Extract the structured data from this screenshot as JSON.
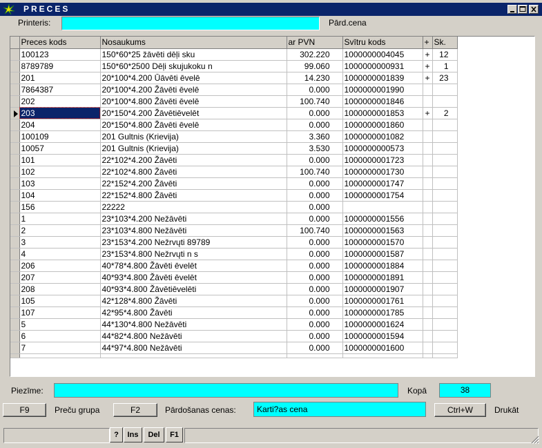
{
  "window": {
    "title": "PRECES"
  },
  "header": {
    "printeris_label": "Printeris:",
    "printeris_value": "",
    "pard_cena_label": "Pārd.cena"
  },
  "table": {
    "columns": [
      "Preces kods",
      "Nosaukums",
      "ar PVN",
      "Svītru kods",
      "+",
      "Sk."
    ],
    "selected_index": 5,
    "rows": [
      [
        "100123",
        "150*60*25 žāvēti dēļi sku",
        "302.220",
        "1000000004045",
        "+",
        "12"
      ],
      [
        "8789789",
        "150*60*2500 Dēļi skujukoku n",
        "99.060",
        "1000000000931",
        "+",
        "1"
      ],
      [
        "201",
        "20*100*4.200 Ūāvēti ēvelē",
        "14.230",
        "1000000001839",
        "+",
        "23"
      ],
      [
        "7864387",
        "20*100*4.200 Žāvēti ēvelē",
        "0.000",
        "1000000001990",
        "",
        ""
      ],
      [
        "202",
        "20*100*4.800 Žāvēti ēvelē",
        "100.740",
        "1000000001846",
        "",
        ""
      ],
      [
        "203",
        "20*150*4.200 Žāvētiēvelēt",
        "0.000",
        "1000000001853",
        "+",
        "2"
      ],
      [
        "204",
        "20*150*4.800 Žāvēti ēvelē",
        "0.000",
        "1000000001860",
        "",
        ""
      ],
      [
        "100109",
        "201 Gultnis (Krievija)",
        "3.360",
        "1000000001082",
        "",
        ""
      ],
      [
        "10057",
        "201 Gultnis (Krievija)",
        "3.530",
        "1000000000573",
        "",
        ""
      ],
      [
        "101",
        "22*102*4.200 Žāvēti",
        "0.000",
        "1000000001723",
        "",
        ""
      ],
      [
        "102",
        "22*102*4.800 Žāvēti",
        "100.740",
        "1000000001730",
        "",
        ""
      ],
      [
        "103",
        "22*152*4.200 Žāvēti",
        "0.000",
        "1000000001747",
        "",
        ""
      ],
      [
        "104",
        "22*152*4.800 Žāvēti",
        "0.000",
        "1000000001754",
        "",
        ""
      ],
      [
        "156",
        "22222",
        "0.000",
        "",
        "",
        ""
      ],
      [
        "1",
        "23*103*4.200 Nežāvēti",
        "0.000",
        "1000000001556",
        "",
        ""
      ],
      [
        "2",
        "23*103*4.800 Nežāvēti",
        "100.740",
        "1000000001563",
        "",
        ""
      ],
      [
        "3",
        "23*153*4.200 Nežrvųti 89789",
        "0.000",
        "1000000001570",
        "",
        ""
      ],
      [
        "4",
        "23*153*4.800 Nežrvųti n s",
        "0.000",
        "1000000001587",
        "",
        ""
      ],
      [
        "206",
        "40*78*4.800 Žāvēti ēvelēt",
        "0.000",
        "1000000001884",
        "",
        ""
      ],
      [
        "207",
        "40*93*4.800 Žāvēti ēvelēt",
        "0.000",
        "1000000001891",
        "",
        ""
      ],
      [
        "208",
        "40*93*4.800 Žāvētiēvelēti",
        "0.000",
        "1000000001907",
        "",
        ""
      ],
      [
        "105",
        "42*128*4.800 Žāvēti",
        "0.000",
        "1000000001761",
        "",
        ""
      ],
      [
        "107",
        "42*95*4.800 Žāvēti",
        "0.000",
        "1000000001785",
        "",
        ""
      ],
      [
        "5",
        "44*130*4.800 Nežāvēti",
        "0.000",
        "1000000001624",
        "",
        ""
      ],
      [
        "6",
        "44*82*4.800 Nežāvēti",
        "0.000",
        "1000000001594",
        "",
        ""
      ],
      [
        "7",
        "44*97*4.800 Nežāvēti",
        "0.000",
        "1000000001600",
        "",
        ""
      ]
    ]
  },
  "footer": {
    "piezime_label": "Piezīme:",
    "piezime_value": "",
    "kopa_label": "Kopā",
    "kopa_value": "38",
    "f9_label": "F9",
    "precu_grupa_label": "Preču grupa",
    "f2_label": "F2",
    "pardosanas_label": "Pārdošanas cenas:",
    "pardosanas_value": "Karti?as cena",
    "ctrlw_label": "Ctrl+W",
    "drukat_label": "Drukāt"
  },
  "statusbar": {
    "help_label": "?",
    "ins_label": "Ins",
    "del_label": "Del",
    "f1_label": "F1"
  },
  "colors": {
    "field": "#00ffff",
    "titlebar": "#0a246a",
    "selection": "#0a246a"
  }
}
